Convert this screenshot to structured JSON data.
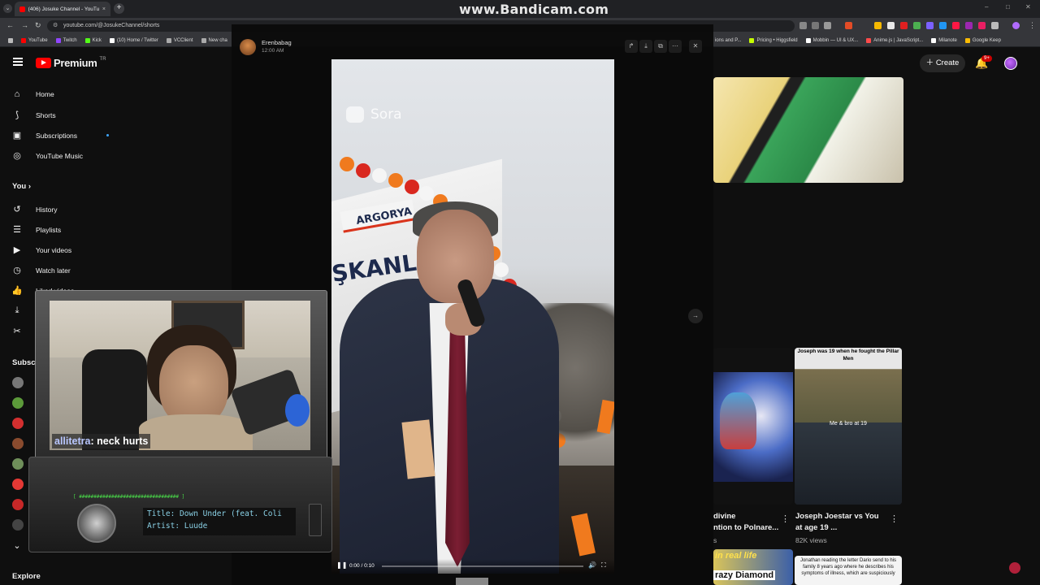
{
  "watermark": "www.Bandicam.com",
  "browser": {
    "tab_title": "(406) Josuke Channel - YouTube",
    "url": "youtube.com/@JosukeChannel/shorts",
    "bookmarks": [
      "YouTube",
      "Twitch",
      "Kick",
      "(10) Home / Twitter",
      "VCClient",
      "New cha",
      "ions and P...",
      "Pricing • Higgsfield",
      "Mobbin — UI & UX...",
      "Anime.js | JavaScript...",
      "Milanote",
      "Google Keep"
    ]
  },
  "youtube": {
    "logo": "Premium",
    "logo_region": "TR",
    "create_label": "Create",
    "notif_count": "9+",
    "nav": [
      {
        "icon": "home-icon",
        "label": "Home"
      },
      {
        "icon": "shorts-icon",
        "label": "Shorts"
      },
      {
        "icon": "subscriptions-icon",
        "label": "Subscriptions"
      },
      {
        "icon": "youtube-music-icon",
        "label": "YouTube Music"
      }
    ],
    "you_heading": "You",
    "you_items": [
      {
        "icon": "history-icon",
        "label": "History"
      },
      {
        "icon": "playlists-icon",
        "label": "Playlists"
      },
      {
        "icon": "your-videos-icon",
        "label": "Your videos"
      },
      {
        "icon": "watch-later-icon",
        "label": "Watch later"
      },
      {
        "icon": "liked-videos-icon",
        "label": "Liked videos"
      }
    ],
    "subs_heading": "Subscri",
    "explore_heading": "Explore",
    "videos": [
      {
        "title_line1": "divine",
        "title_line2": "ntion to Polnare...",
        "views": "s"
      },
      {
        "title_line1": "Joseph Joestar vs You",
        "title_line2": "at age 19 ...",
        "views": "82K views"
      }
    ],
    "thumb_text": {
      "joseph_top": "Joseph was 19 when he fought the Pillar Men",
      "joseph_bottom": "Me & bro at 19",
      "crazy": "in real life",
      "crazy2": "razy Diamond",
      "jonathan": "Jonathan reading the letter Dario send to his family 8 years ago where he describes his symptoms of illness, which are suspiciously"
    }
  },
  "viewer": {
    "poster_name": "Erenbabag",
    "poster_time": "12:00 AM",
    "video_watermark": "Sora",
    "banner_text_1": "ARGORYA",
    "banner_text_2": "ŞKANLI",
    "time": "0:00 / 0:10",
    "progress": 0
  },
  "stream": {
    "chat_user": "allitetra",
    "chat_msg": ": neck hurts",
    "radio_title": "Title: Down Under (feat. Coli",
    "radio_artist": "Artist: Luude",
    "radio_eq": "[ ################################## ]"
  },
  "colors": {
    "yt_red": "#ff0000",
    "accent_blue": "#3ea6ff",
    "lcd_text": "#8ad1e6"
  }
}
